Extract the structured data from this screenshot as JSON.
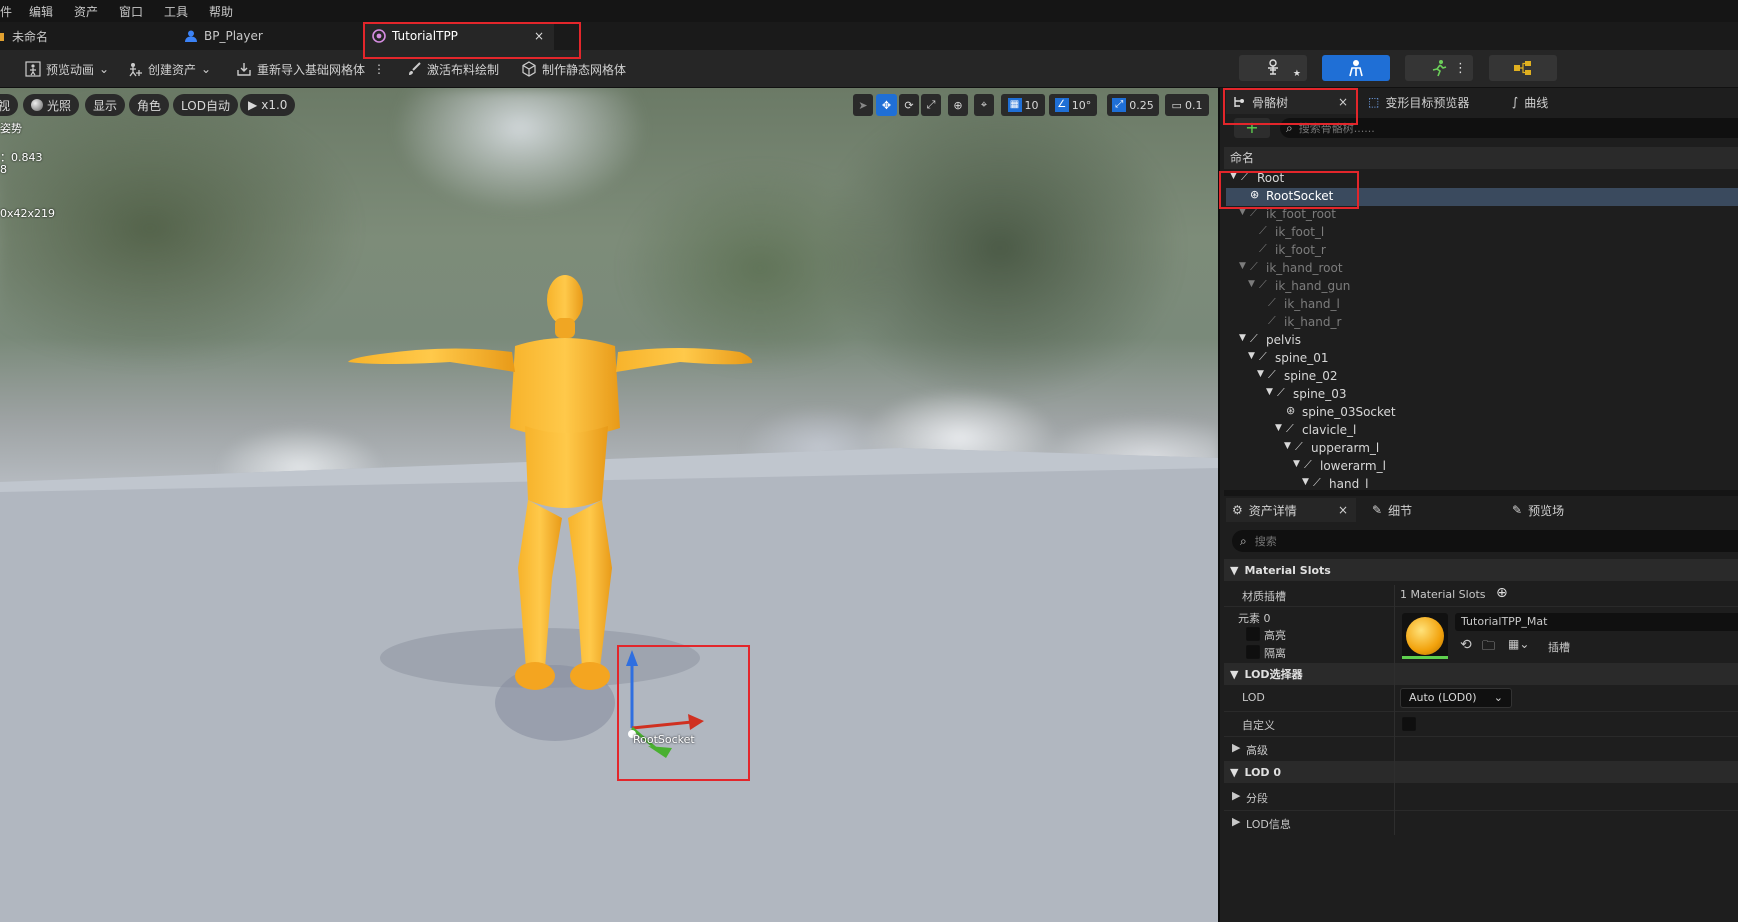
{
  "menu": [
    "件",
    "编辑",
    "资产",
    "窗口",
    "工具",
    "帮助"
  ],
  "tabs": [
    {
      "label": "未命名",
      "icon": "level-icon"
    },
    {
      "label": "BP_Player",
      "icon": "blueprint-icon"
    },
    {
      "label": "TutorialTPP",
      "icon": "skeletal-mesh-icon",
      "close": "×"
    }
  ],
  "toolbar": {
    "preview_animation": "预览动画",
    "create_asset": "创建资产",
    "reimport_base_mesh": "重新导入基础网格体",
    "activate_cloth_paint": "激活布料绘制",
    "make_static_mesh": "制作静态网格体",
    "more": "⋮"
  },
  "viewport": {
    "view_mode": "视",
    "lighting": "光照",
    "show": "显示",
    "character": "角色",
    "lod": "LOD自动",
    "speed": "x1.0",
    "grid_snap": "10",
    "angle_snap": "10°",
    "scale_snap": "0.25",
    "camera_speed": "0.1",
    "stats": [
      "姿势",
      "：0.843",
      "8",
      "0x42x219"
    ],
    "socket_label": "RootSocket"
  },
  "right_panel": {
    "tabs": [
      {
        "label": "骨骼树",
        "icon": "skeleton-tree-icon",
        "close": "×"
      },
      {
        "label": "变形目标预览器",
        "icon": "morph-target-icon"
      },
      {
        "label": "曲线",
        "icon": "curve-icon"
      }
    ],
    "add_button": "+",
    "search_placeholder": "搜索骨骼树......",
    "column_name": "命名",
    "bones": [
      {
        "label": "Root",
        "depth": 0,
        "type": "bone",
        "expanded": true
      },
      {
        "label": "RootSocket",
        "depth": 1,
        "type": "socket",
        "selected": true
      },
      {
        "label": "ik_foot_root",
        "depth": 1,
        "type": "bone",
        "expanded": true,
        "dim": true
      },
      {
        "label": "ik_foot_l",
        "depth": 2,
        "type": "bone",
        "dim": true
      },
      {
        "label": "ik_foot_r",
        "depth": 2,
        "type": "bone",
        "dim": true
      },
      {
        "label": "ik_hand_root",
        "depth": 1,
        "type": "bone",
        "expanded": true,
        "dim": true
      },
      {
        "label": "ik_hand_gun",
        "depth": 2,
        "type": "bone",
        "expanded": true,
        "dim": true
      },
      {
        "label": "ik_hand_l",
        "depth": 3,
        "type": "bone",
        "dim": true
      },
      {
        "label": "ik_hand_r",
        "depth": 3,
        "type": "bone",
        "dim": true
      },
      {
        "label": "pelvis",
        "depth": 1,
        "type": "bone",
        "expanded": true
      },
      {
        "label": "spine_01",
        "depth": 2,
        "type": "bone",
        "expanded": true
      },
      {
        "label": "spine_02",
        "depth": 3,
        "type": "bone",
        "expanded": true
      },
      {
        "label": "spine_03",
        "depth": 4,
        "type": "bone",
        "expanded": true
      },
      {
        "label": "spine_03Socket",
        "depth": 5,
        "type": "socket"
      },
      {
        "label": "clavicle_l",
        "depth": 5,
        "type": "bone",
        "expanded": true
      },
      {
        "label": "upperarm_l",
        "depth": 6,
        "type": "bone",
        "expanded": true
      },
      {
        "label": "lowerarm_l",
        "depth": 7,
        "type": "bone",
        "expanded": true
      },
      {
        "label": "hand_l",
        "depth": 8,
        "type": "bone",
        "expanded": true
      }
    ],
    "details_tabs": [
      {
        "label": "资产详情",
        "icon": "asset-details-icon",
        "close": "×"
      },
      {
        "label": "细节",
        "icon": "details-icon"
      },
      {
        "label": "预览场",
        "icon": "preview-scene-icon"
      }
    ],
    "details_search_placeholder": "搜索",
    "material_slots_header": "Material Slots",
    "material_slots_label": "材质插槽",
    "material_slots_value": "1 Material Slots",
    "element_label": "元素 0",
    "highlight_label": "高亮",
    "isolate_label": "隔离",
    "material_name": "TutorialTPP_Mat",
    "slot_label": "插槽",
    "lod_selector_header": "LOD选择器",
    "lod_label": "LOD",
    "lod_value": "Auto (LOD0)",
    "custom_label": "自定义",
    "advanced_label": "高级",
    "lod0_header": "LOD 0",
    "sections_label": "分段",
    "lod_info_label": "LOD信息"
  },
  "colors": {
    "accent_blue": "#1f6fd6",
    "highlight_red": "#e3262b",
    "mannequin": "#f5a623",
    "selection": "#3a4a5e"
  }
}
